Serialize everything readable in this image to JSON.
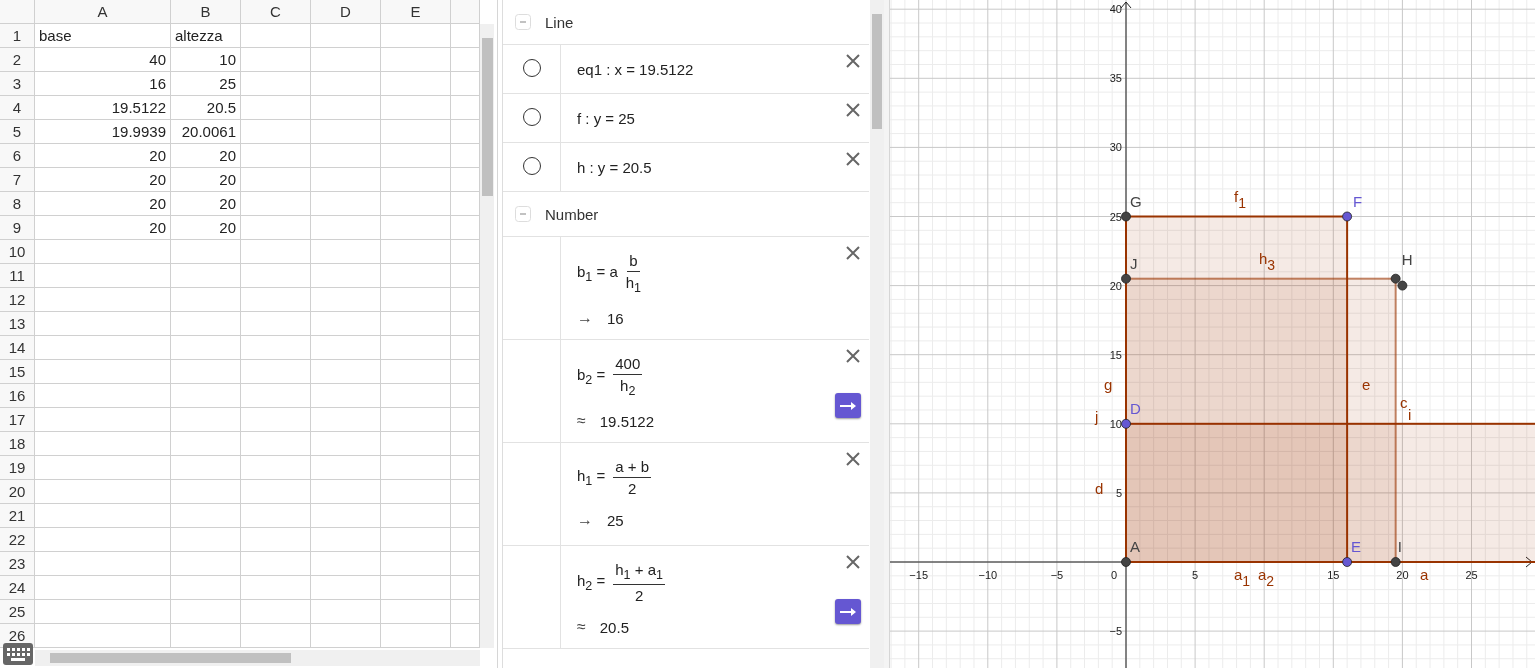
{
  "spreadsheet": {
    "columns": [
      "A",
      "B",
      "C",
      "D",
      "E"
    ],
    "rows": [
      {
        "number": "1",
        "cells": [
          {
            "text": "base",
            "kind": "text"
          },
          {
            "text": "altezza",
            "kind": "text"
          }
        ]
      },
      {
        "number": "2",
        "cells": [
          {
            "text": "40",
            "kind": "number"
          },
          {
            "text": "10",
            "kind": "number"
          }
        ]
      },
      {
        "number": "3",
        "cells": [
          {
            "text": "16",
            "kind": "number"
          },
          {
            "text": "25",
            "kind": "number"
          }
        ]
      },
      {
        "number": "4",
        "cells": [
          {
            "text": "19.5122",
            "kind": "number"
          },
          {
            "text": "20.5",
            "kind": "number"
          }
        ]
      },
      {
        "number": "5",
        "cells": [
          {
            "text": "19.9939",
            "kind": "number"
          },
          {
            "text": "20.0061",
            "kind": "number"
          }
        ]
      },
      {
        "number": "6",
        "cells": [
          {
            "text": "20",
            "kind": "number"
          },
          {
            "text": "20",
            "kind": "number"
          }
        ]
      },
      {
        "number": "7",
        "cells": [
          {
            "text": "20",
            "kind": "number"
          },
          {
            "text": "20",
            "kind": "number"
          }
        ]
      },
      {
        "number": "8",
        "cells": [
          {
            "text": "20",
            "kind": "number"
          },
          {
            "text": "20",
            "kind": "number"
          }
        ]
      },
      {
        "number": "9",
        "cells": [
          {
            "text": "20",
            "kind": "number"
          },
          {
            "text": "20",
            "kind": "number"
          }
        ]
      },
      {
        "number": "10"
      },
      {
        "number": "11"
      },
      {
        "number": "12"
      },
      {
        "number": "13"
      },
      {
        "number": "14"
      },
      {
        "number": "15"
      },
      {
        "number": "16"
      },
      {
        "number": "17"
      },
      {
        "number": "18"
      },
      {
        "number": "19"
      },
      {
        "number": "20"
      },
      {
        "number": "21"
      },
      {
        "number": "22"
      },
      {
        "number": "23"
      },
      {
        "number": "24"
      },
      {
        "number": "25"
      },
      {
        "number": "26"
      }
    ]
  },
  "algebra": {
    "groups": [
      {
        "title": "Line",
        "expanded": true,
        "items": [
          {
            "kind": "equation",
            "visible": false,
            "text": "eq1 : x = 19.5122"
          },
          {
            "kind": "equation",
            "visible": false,
            "text": "f : y = 25"
          },
          {
            "kind": "equation",
            "visible": false,
            "text": "h : y = 20.5"
          }
        ]
      },
      {
        "title": "Number",
        "expanded": true,
        "items": [
          {
            "kind": "fraction",
            "lhs": "b$_{1}$ = a",
            "numerator": "b",
            "denominator": "h$_{1}$",
            "result_symbol": "→",
            "result": "16",
            "toggle_button": false
          },
          {
            "kind": "fraction",
            "lhs": "b$_{2}$ =",
            "numerator": "400",
            "denominator": "h$_{2}$",
            "result_symbol": "≈",
            "result": "19.5122",
            "toggle_button": true
          },
          {
            "kind": "fraction",
            "lhs": "h$_{1}$ =",
            "numerator": "a + b",
            "denominator": "2",
            "result_symbol": "→",
            "result": "25",
            "toggle_button": false
          },
          {
            "kind": "fraction",
            "lhs": "h$_{2}$ =",
            "numerator": "h$_{1}$ + a$_{1}$",
            "denominator": "2",
            "result_symbol": "≈",
            "result": "20.5",
            "toggle_button": true
          }
        ]
      }
    ]
  },
  "graph": {
    "x_ticks": [
      "−15",
      "−10",
      "−5",
      "0",
      "5",
      "15",
      "20",
      "25"
    ],
    "y_ticks": [
      "40",
      "35",
      "30",
      "25",
      "20",
      "15",
      "10",
      "5",
      "−5"
    ],
    "points": [
      {
        "label": "G",
        "color": "#444444"
      },
      {
        "label": "F",
        "color": "#6557d2"
      },
      {
        "label": "J",
        "color": "#444444"
      },
      {
        "label": "H",
        "color": "#444444"
      },
      {
        "color": "#444444"
      },
      {
        "label": "D",
        "color": "#6557d2"
      },
      {
        "label": "A",
        "color": "#444444"
      },
      {
        "label": "E",
        "color": "#6557d2"
      },
      {
        "label": "I",
        "color": "#444444"
      }
    ],
    "line_labels": [
      {
        "name": "f",
        "sub": "1"
      },
      {
        "name": "h",
        "sub": "3"
      },
      {
        "name": "g"
      },
      {
        "name": "j"
      },
      {
        "name": "e"
      },
      {
        "name": "c"
      },
      {
        "name": "i"
      },
      {
        "name": "d"
      },
      {
        "name": "a",
        "sub": "1"
      },
      {
        "name": "a",
        "sub": "2"
      },
      {
        "name": "a"
      }
    ]
  }
}
